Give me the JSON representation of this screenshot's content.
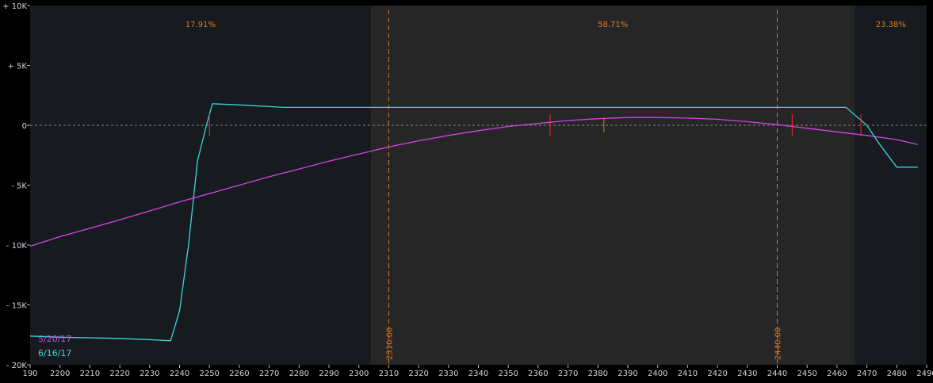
{
  "chart_data": {
    "type": "line",
    "xlim": [
      2190,
      2490
    ],
    "ylim": [
      -20000,
      10000
    ],
    "x_ticks": [
      "190",
      "2200",
      "2210",
      "2220",
      "2230",
      "2240",
      "2250",
      "2260",
      "2270",
      "2280",
      "2290",
      "2300",
      "2310",
      "2320",
      "2330",
      "2340",
      "2350",
      "2360",
      "2370",
      "2380",
      "2390",
      "2400",
      "2410",
      "2420",
      "2430",
      "2440",
      "2450",
      "2460",
      "2470",
      "2480",
      "2490"
    ],
    "y_ticks": [
      {
        "value": 10000,
        "label": "+ 10K"
      },
      {
        "value": 5000,
        "label": "+ 5K"
      },
      {
        "value": 0,
        "label": "0"
      },
      {
        "value": -5000,
        "label": "- 5K"
      },
      {
        "value": -10000,
        "label": "- 10K"
      },
      {
        "value": -15000,
        "label": "- 15K"
      },
      {
        "value": -20000,
        "label": "- 20K"
      }
    ],
    "zones": [
      {
        "from": 2190,
        "to": 2304,
        "shade": "dark",
        "label": "17.91%"
      },
      {
        "from": 2304,
        "to": 2466,
        "shade": "light",
        "label": "58.71%"
      },
      {
        "from": 2466,
        "to": 2490,
        "shade": "dark",
        "label": "23.38%"
      }
    ],
    "vlines": [
      {
        "x": 2310,
        "label": "2310.00"
      },
      {
        "x": 2440,
        "label": "2440.00"
      }
    ],
    "zero_line": true,
    "series": [
      {
        "name": "5/20/17",
        "color": "#d642e8",
        "x": [
          2190,
          2200,
          2210,
          2220,
          2230,
          2240,
          2250,
          2260,
          2270,
          2280,
          2290,
          2300,
          2310,
          2320,
          2330,
          2340,
          2350,
          2360,
          2370,
          2380,
          2390,
          2400,
          2410,
          2420,
          2430,
          2440,
          2450,
          2460,
          2470,
          2480,
          2487
        ],
        "y": [
          -10100,
          -9300,
          -8600,
          -7900,
          -7150,
          -6400,
          -5700,
          -5000,
          -4300,
          -3650,
          -3000,
          -2400,
          -1800,
          -1300,
          -850,
          -450,
          -100,
          150,
          400,
          550,
          650,
          650,
          600,
          500,
          300,
          50,
          -250,
          -550,
          -850,
          -1200,
          -1600
        ],
        "markers": [
          {
            "x": 2250,
            "y": 0,
            "color": "#ff2a2a",
            "size": "big"
          },
          {
            "x": 2364,
            "y": 0,
            "color": "#ff2a2a",
            "size": "big"
          },
          {
            "x": 2382,
            "y": 0,
            "color": "#c8862a",
            "size": "small"
          },
          {
            "x": 2445,
            "y": 0,
            "color": "#ff2a2a",
            "size": "big"
          },
          {
            "x": 2468,
            "y": 0,
            "color": "#ff2a2a",
            "size": "big"
          }
        ]
      },
      {
        "name": "6/16/17",
        "color": "#3ad4dc",
        "x": [
          2190,
          2200,
          2210,
          2220,
          2230,
          2237,
          2240,
          2243,
          2246,
          2249,
          2251,
          2260,
          2275,
          2300,
          2350,
          2400,
          2450,
          2463,
          2470,
          2474,
          2477,
          2480,
          2487
        ],
        "y": [
          -17600,
          -17700,
          -17750,
          -17800,
          -17900,
          -18000,
          -15500,
          -10000,
          -3000,
          0,
          1800,
          1700,
          1500,
          1500,
          1500,
          1500,
          1500,
          1500,
          0,
          -1500,
          -2500,
          -3500,
          -3500
        ]
      }
    ]
  }
}
